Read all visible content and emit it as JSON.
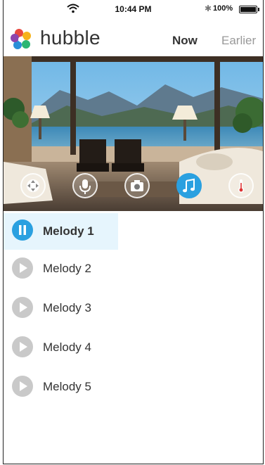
{
  "status_bar": {
    "time": "10:44 PM",
    "battery": "100%",
    "battery_level": 1.0
  },
  "header": {
    "brand": "hubble",
    "tabs": [
      "Now",
      "Earlier"
    ],
    "active_tab": "Now"
  },
  "controls": [
    {
      "name": "pan-tilt-icon",
      "active": false
    },
    {
      "name": "microphone-icon",
      "active": false
    },
    {
      "name": "camera-icon",
      "active": false
    },
    {
      "name": "music-note-icon",
      "active": true
    },
    {
      "name": "thermometer-icon",
      "active": false
    }
  ],
  "melodies": {
    "items": [
      {
        "label": "Melody 1",
        "state": "playing"
      },
      {
        "label": "Melody 2",
        "state": "stopped"
      },
      {
        "label": "Melody 3",
        "state": "stopped"
      },
      {
        "label": "Melody 4",
        "state": "stopped"
      },
      {
        "label": "Melody 5",
        "state": "stopped"
      }
    ]
  },
  "colors": {
    "accent": "#2aa0e0",
    "active_row_bg": "#e6f5fd",
    "inactive_play": "#c9c9c9"
  }
}
